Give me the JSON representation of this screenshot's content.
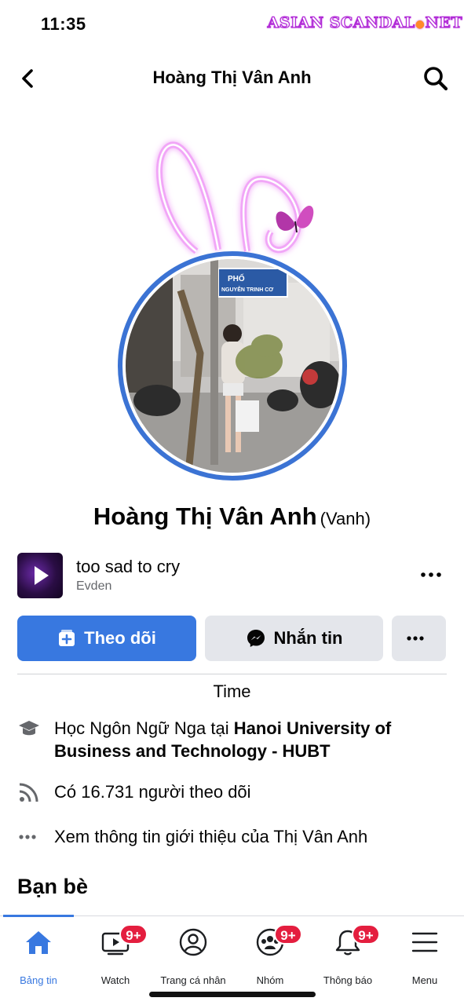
{
  "status": {
    "time": "11:35"
  },
  "watermark": {
    "part1": "ASIAN",
    "part2": "SCANDAL",
    "dot": "●",
    "part3": "NET"
  },
  "nav": {
    "title": "Hoàng Thị Vân Anh",
    "back_icon": "chevron-left-icon",
    "search_icon": "search-icon"
  },
  "avatar": {
    "sign_text": "PHỐ NGUYỄN TRINH CƠ",
    "sign_top": "PHỐ",
    "sign_bottom": "NGUYỄN TRINH CƠ"
  },
  "profile": {
    "name": "Hoàng Thị Vân Anh",
    "alternate_name": "(Vanh)"
  },
  "music": {
    "title": "too sad to cry",
    "artist": "Evden"
  },
  "actions": {
    "follow_label": "Theo dõi",
    "message_label": "Nhắn tin"
  },
  "tabs_strip": {
    "time_label": "Time"
  },
  "info": {
    "education_prefix": "Học Ngôn Ngữ Nga tại ",
    "education_school": "Hanoi University of Business and Technology - HUBT",
    "followers": "Có 16.731 người theo dõi",
    "see_about": "Xem thông tin giới thiệu của Thị Vân Anh"
  },
  "friends": {
    "heading": "Bạn bè"
  },
  "tabbar": {
    "items": [
      {
        "label": "Bảng tin",
        "icon": "home-icon",
        "badge": ""
      },
      {
        "label": "Watch",
        "icon": "watch-icon",
        "badge": "9+"
      },
      {
        "label": "Trang cá nhân",
        "icon": "profile-icon",
        "badge": ""
      },
      {
        "label": "Nhóm",
        "icon": "groups-icon",
        "badge": "9+"
      },
      {
        "label": "Thông báo",
        "icon": "bell-icon",
        "badge": "9+"
      },
      {
        "label": "Menu",
        "icon": "menu-icon",
        "badge": ""
      }
    ]
  },
  "colors": {
    "accent": "#3878e0",
    "badge": "#e41e3f",
    "ring": "#3b73d4",
    "neon": "#e77cf2",
    "secondary_text": "#65676b"
  }
}
